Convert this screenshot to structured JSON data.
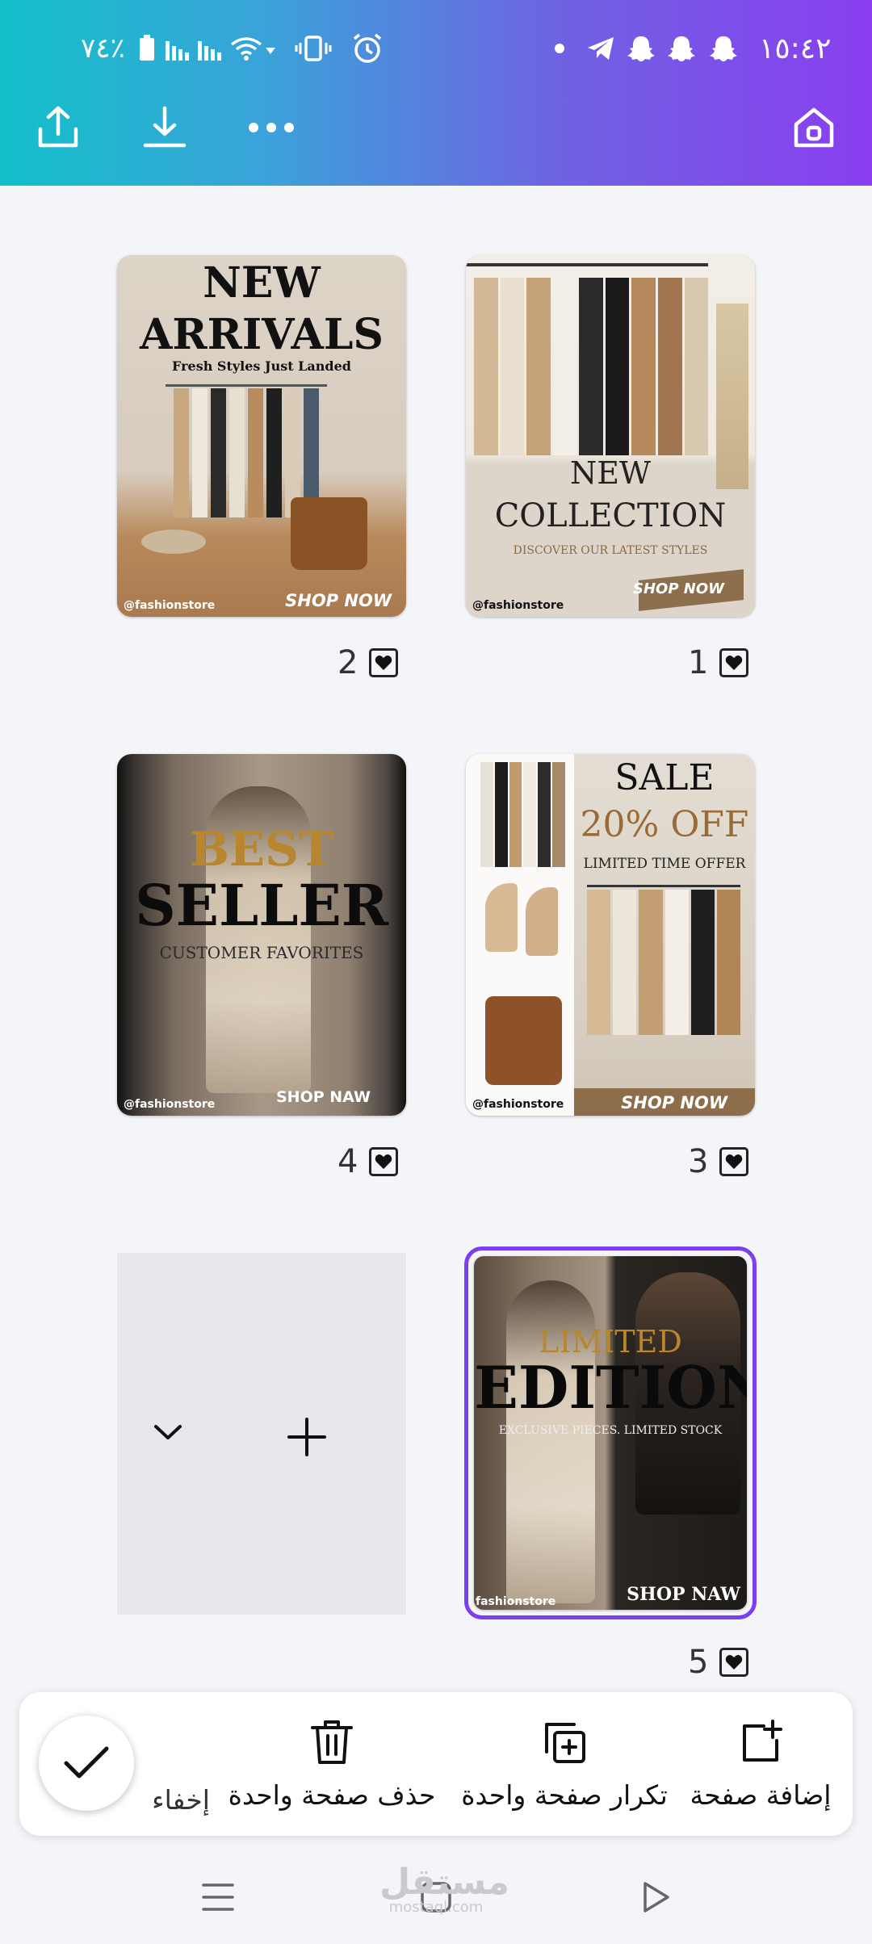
{
  "status_bar": {
    "time": "١٥:٤٢",
    "battery": "٧٤٪"
  },
  "toolbar": {
    "share_icon": "share-icon",
    "download_icon": "download-icon",
    "more_icon": "more-icon",
    "home_icon": "home-icon"
  },
  "pages": [
    {
      "number": "1",
      "heading": "NEW",
      "heading2": "COLLECTION",
      "tagline": "DISCOVER OUR LATEST STYLES",
      "cta": "SHOP NOW",
      "handle": "@fashionstore"
    },
    {
      "number": "2",
      "heading": "NEW",
      "heading2": "ARRIVALS",
      "tagline": "Fresh Styles Just Landed",
      "cta": "SHOP NOW",
      "handle": "@fashionstore"
    },
    {
      "number": "3",
      "heading": "SALE",
      "heading2": "20% OFF",
      "tagline": "LIMITED TIME OFFER",
      "cta": "SHOP NOW",
      "handle": "@fashionstore"
    },
    {
      "number": "4",
      "heading": "BEST",
      "heading2": "SELLER",
      "tagline": "CUSTOMER FAVORITES",
      "cta": "SHOP NAW",
      "handle": "@fashionstore"
    },
    {
      "number": "5",
      "heading": "LIMITED",
      "heading2": "EDITION",
      "tagline": "EXCLUSIVE PIECES. LIMITED STOCK",
      "cta": "SHOP NAW",
      "handle": "fashionstore"
    }
  ],
  "actions": {
    "add_page": "إضافة صفحة",
    "duplicate_page": "تكرار صفحة واحدة",
    "delete_page": "حذف صفحة واحدة",
    "hide": "إخفاء"
  },
  "watermark": {
    "text": "مستقل",
    "sub": "mostaql.com"
  },
  "colors": {
    "accent": "#7b3ff0",
    "gold": "#b8862f"
  }
}
